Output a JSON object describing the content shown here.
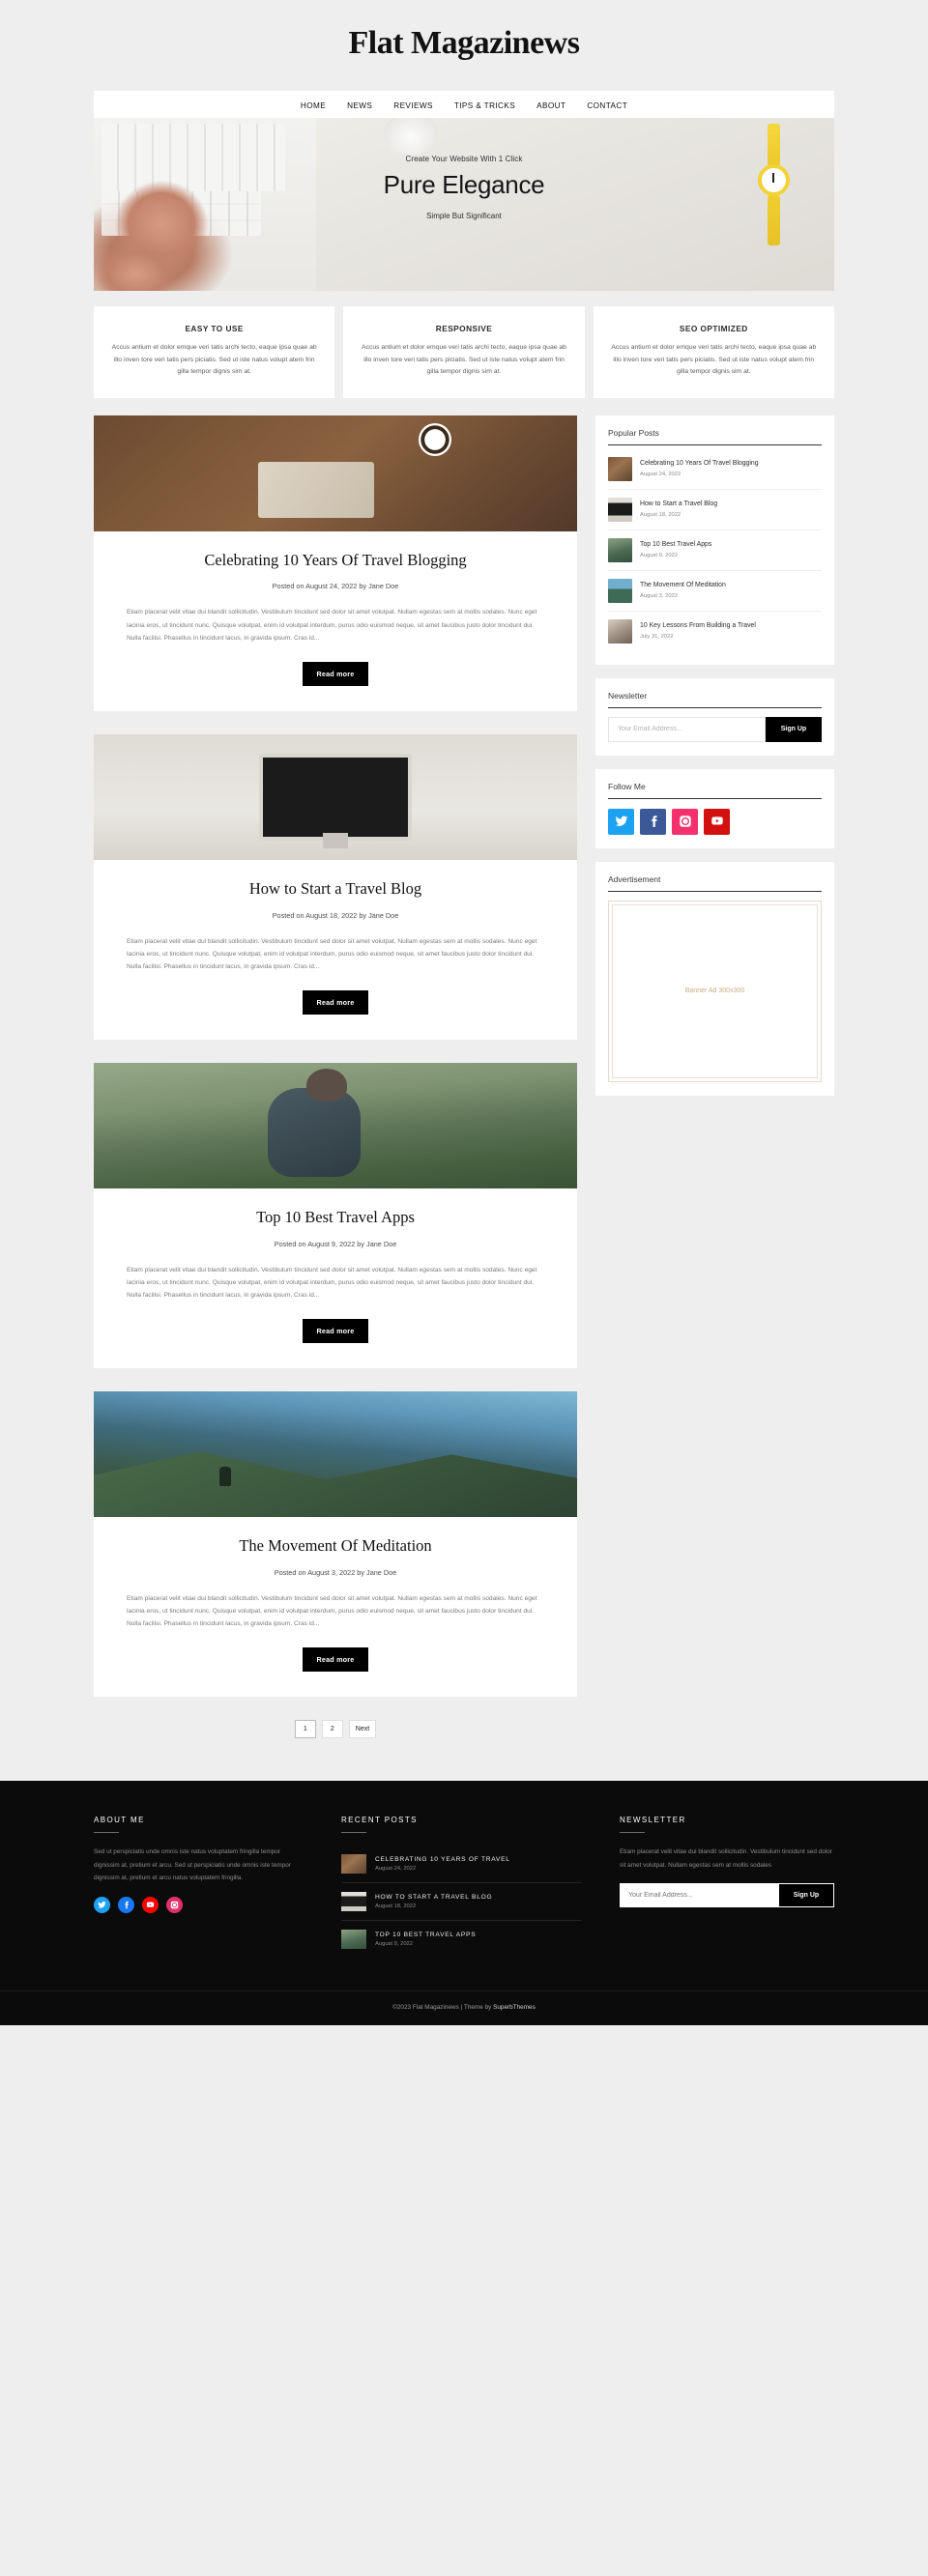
{
  "site": {
    "title": "Flat Magazinews"
  },
  "nav": {
    "items": [
      {
        "label": "HOME"
      },
      {
        "label": "NEWS"
      },
      {
        "label": "REVIEWS"
      },
      {
        "label": "TIPS & TRICKS"
      },
      {
        "label": "ABOUT"
      },
      {
        "label": "CONTACT"
      }
    ]
  },
  "hero": {
    "eyebrow": "Create Your Website With 1 Click",
    "title": "Pure Elegance",
    "subtitle": "Simple But Significant"
  },
  "features": [
    {
      "title": "EASY TO USE",
      "text": "Accus antium et dolor emque veri tatis archi tecto, eaque ipsa quae ab illo inven tore veri tatis pers piciatis. Sed ut iste natus volupt atem frin gilla tempor dignis sim at."
    },
    {
      "title": "RESPONSIVE",
      "text": "Accus antium et dolor emque veri tatis archi tecto, eaque ipsa quae ab illo inven tore veri tatis pers piciatis. Sed ut iste natus volupt atem frin gilla tempor dignis sim at."
    },
    {
      "title": "SEO OPTIMIZED",
      "text": "Accus antium et dolor emque veri tatis archi tecto, eaque ipsa quae ab illo inven tore veri tatis pers piciatis. Sed ut iste natus volupt atem frin gilla tempor dignis sim at."
    }
  ],
  "posts": [
    {
      "title": "Celebrating 10 Years Of Travel Blogging",
      "meta": "Posted on August 24, 2022 by Jane Doe",
      "excerpt": "Etiam placerat velit vitae dui blandit sollicitudin. Vestibulum tincidunt sed dolor sit amet volutpat. Nullam egestas sem at mollis sodales. Nunc eget lacinia eros, ut tincidunt nunc. Quisque volutpat, enim id volutpat interdum, purus odio euismod neque, sit amet faucibus justo dolor tincidunt dui. Nulla facilisi. Phasellus in tincidunt lacus, in gravida ipsum. Cras id...",
      "readmore": "Read more"
    },
    {
      "title": "How to Start a Travel Blog",
      "meta": "Posted on August 18, 2022 by Jane Doe",
      "excerpt": "Etiam placerat velit vitae dui blandit sollicitudin. Vestibulum tincidunt sed dolor sit amet volutpat. Nullam egestas sem at mollis sodales. Nunc eget lacinia eros, ut tincidunt nunc. Quisque volutpat, enim id volutpat interdum, purus odio euismod neque, sit amet faucibus justo dolor tincidunt dui. Nulla facilisi. Phasellus in tincidunt lacus, in gravida ipsum. Cras id...",
      "readmore": "Read more"
    },
    {
      "title": "Top 10 Best Travel Apps",
      "meta": "Posted on August 9, 2022 by Jane Doe",
      "excerpt": "Etiam placerat velit vitae dui blandit sollicitudin. Vestibulum tincidunt sed dolor sit amet volutpat. Nullam egestas sem at mollis sodales. Nunc eget lacinia eros, ut tincidunt nunc. Quisque volutpat, enim id volutpat interdum, purus odio euismod neque, sit amet faucibus justo dolor tincidunt dui. Nulla facilisi. Phasellus in tincidunt lacus, in gravida ipsum. Cras id...",
      "readmore": "Read more"
    },
    {
      "title": "The Movement Of Meditation",
      "meta": "Posted on August 3, 2022 by Jane Doe",
      "excerpt": "Etiam placerat velit vitae dui blandit sollicitudin. Vestibulum tincidunt sed dolor sit amet volutpat. Nullam egestas sem at mollis sodales. Nunc eget lacinia eros, ut tincidunt nunc. Quisque volutpat, enim id volutpat interdum, purus odio euismod neque, sit amet faucibus justo dolor tincidunt dui. Nulla facilisi. Phasellus in tincidunt lacus, in gravida ipsum. Cras id...",
      "readmore": "Read more"
    }
  ],
  "pagination": {
    "pages": [
      {
        "label": "1"
      },
      {
        "label": "2"
      },
      {
        "label": "Next"
      }
    ]
  },
  "sidebar": {
    "popular": {
      "title": "Popular Posts",
      "items": [
        {
          "title": "Celebrating 10 Years Of Travel Blogging",
          "date": "August 24, 2022"
        },
        {
          "title": "How to Start a Travel Blog",
          "date": "August 18, 2022"
        },
        {
          "title": "Top 10 Best Travel Apps",
          "date": "August 9, 2022"
        },
        {
          "title": "The Movement Of Meditation",
          "date": "August 3, 2022"
        },
        {
          "title": "10 Key Lessons From Building a Travel",
          "date": "July 31, 2022"
        }
      ]
    },
    "newsletter": {
      "title": "Newsletter",
      "placeholder": "Your Email Address...",
      "button": "Sign Up"
    },
    "follow": {
      "title": "Follow Me",
      "items": [
        {
          "name": "twitter-icon",
          "color": "#1da1f2"
        },
        {
          "name": "facebook-icon",
          "color": "#3b5998"
        },
        {
          "name": "instagram-icon",
          "color": "#f4306d"
        },
        {
          "name": "youtube-icon",
          "color": "#d40f0f"
        }
      ]
    },
    "advertisement": {
      "title": "Advertisement",
      "placeholder": "Banner Ad 300x300"
    }
  },
  "footer": {
    "about": {
      "title": "About Me",
      "text": "Sed ut perspiciatis unde omnis iste natus voluptatem fringilla tempor dignissim at, pretium et arcu. Sed ut perspiciatis unde omnis iste tempor dignissim at, pretium et arcu natus voluptatem fringilla.",
      "socials": [
        {
          "name": "twitter-icon",
          "color": "#1da1f2"
        },
        {
          "name": "facebook-icon",
          "color": "#1877f2"
        },
        {
          "name": "youtube-icon",
          "color": "#ff0000"
        },
        {
          "name": "instagram-icon",
          "color": "#e1306c"
        }
      ]
    },
    "recent": {
      "title": "Recent Posts",
      "items": [
        {
          "title": "CELEBRATING 10 YEARS OF TRAVEL",
          "date": "August 24, 2022"
        },
        {
          "title": "HOW TO START A TRAVEL BLOG",
          "date": "August 18, 2022"
        },
        {
          "title": "TOP 10 BEST TRAVEL APPS",
          "date": "August 9, 2022"
        }
      ]
    },
    "newsletter": {
      "title": "Newsletter",
      "text": "Etiam placerat velit vitae dui blandit sollicitudin. Vestibulum tincidunt sed dolor sit amet volutpat. Nullam egestas sem at mollis sodales",
      "placeholder": "Your Email Address...",
      "button": "Sign Up"
    },
    "copyright": "©2023 Flat Magazinews | Theme by ",
    "copyright_link": "SuperbThemes"
  }
}
